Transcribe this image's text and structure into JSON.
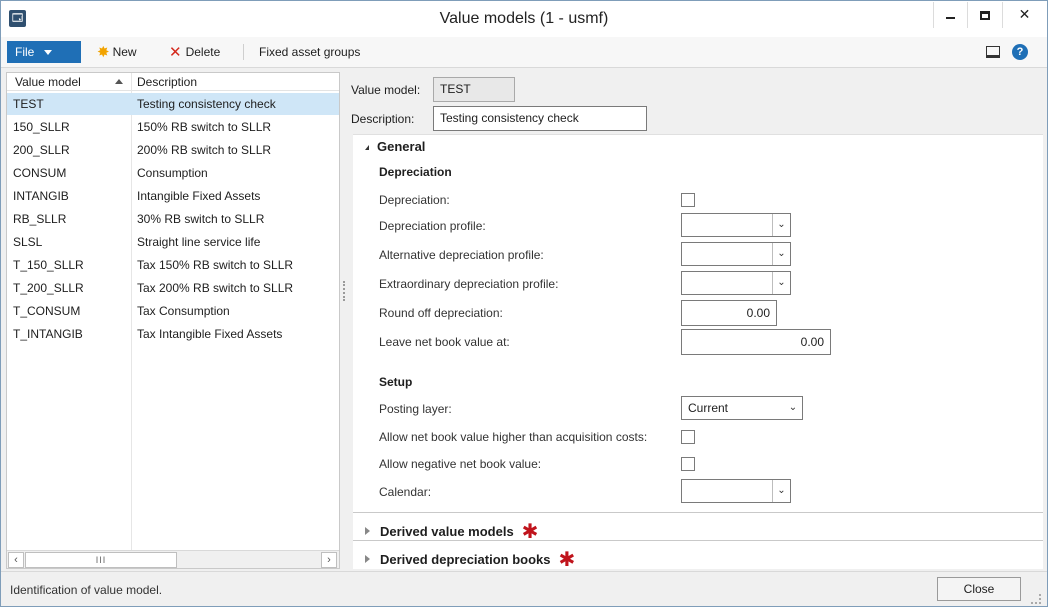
{
  "window": {
    "app_icon_text": "🗔",
    "title": "Value models (1 - usmf)"
  },
  "toolbar": {
    "file_label": "File",
    "new_label": "New",
    "delete_label": "Delete",
    "fixed_asset_groups_label": "Fixed asset groups"
  },
  "list": {
    "columns": [
      "Value model",
      "Description"
    ],
    "rows": [
      {
        "model": "TEST",
        "description": "Testing consistency check",
        "selected": true
      },
      {
        "model": "150_SLLR",
        "description": "150% RB switch to SLLR"
      },
      {
        "model": "200_SLLR",
        "description": "200% RB switch to SLLR"
      },
      {
        "model": "CONSUM",
        "description": "Consumption"
      },
      {
        "model": "INTANGIB",
        "description": "Intangible Fixed Assets"
      },
      {
        "model": "RB_SLLR",
        "description": "30% RB switch to SLLR"
      },
      {
        "model": "SLSL",
        "description": "Straight line service life"
      },
      {
        "model": "T_150_SLLR",
        "description": "Tax 150% RB switch to SLLR"
      },
      {
        "model": "T_200_SLLR",
        "description": "Tax 200% RB switch to SLLR"
      },
      {
        "model": "T_CONSUM",
        "description": "Tax Consumption"
      },
      {
        "model": "T_INTANGIB",
        "description": "Tax Intangible Fixed Assets"
      }
    ],
    "scroll_thumb": "III"
  },
  "detail": {
    "value_model_label": "Value model:",
    "value_model_value": "TEST",
    "description_label": "Description:",
    "description_value": "Testing consistency check",
    "general_tab": "General",
    "depreciation_group": "Depreciation",
    "depreciation_label": "Depreciation:",
    "depreciation_profile_label": "Depreciation profile:",
    "alt_depreciation_profile_label": "Alternative depreciation profile:",
    "extra_depreciation_profile_label": "Extraordinary depreciation profile:",
    "round_off_label": "Round off depreciation:",
    "round_off_value": "0.00",
    "leave_nbv_label": "Leave net book value at:",
    "leave_nbv_value": "0.00",
    "setup_group": "Setup",
    "posting_layer_label": "Posting layer:",
    "posting_layer_value": "Current",
    "allow_nbv_higher_label": "Allow net book value higher than acquisition costs:",
    "allow_negative_nbv_label": "Allow negative net book value:",
    "calendar_label": "Calendar:",
    "derived_value_models_tab": "Derived value models",
    "derived_depreciation_books_tab": "Derived depreciation books"
  },
  "status": {
    "text": "Identification of value model.",
    "close_label": "Close"
  }
}
